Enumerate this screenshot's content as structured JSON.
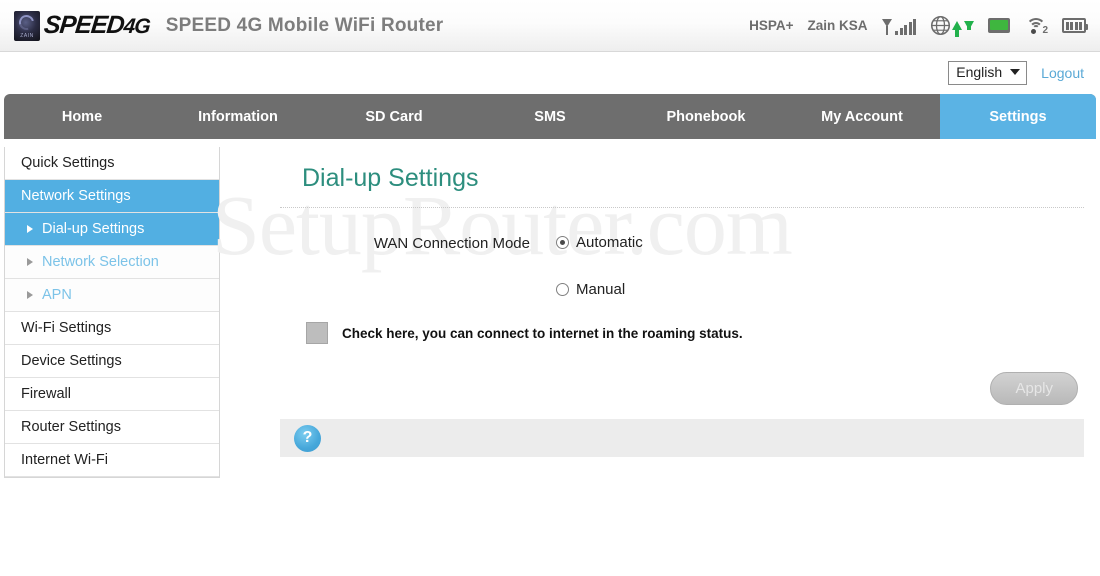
{
  "header": {
    "logo_mark": "zain-speed4g-logo",
    "logo_text_main": "SPEED",
    "logo_text_suffix": "4G",
    "logo_badge_text": "ZAIN",
    "title": "SPEED 4G Mobile WiFi Router",
    "status": {
      "network_type": "HSPA+",
      "carrier": "Zain KSA",
      "signal_icon": "signal-bars-icon",
      "data_icon": "globe-transfer-icon",
      "sms_icon": "sms-icon",
      "wifi_icon": "wifi-icon",
      "wifi_clients": "2",
      "battery_icon": "battery-icon"
    }
  },
  "subheader": {
    "language": "English",
    "logout": "Logout"
  },
  "nav": {
    "items": [
      {
        "label": "Home",
        "active": false
      },
      {
        "label": "Information",
        "active": false
      },
      {
        "label": "SD Card",
        "active": false
      },
      {
        "label": "SMS",
        "active": false
      },
      {
        "label": "Phonebook",
        "active": false
      },
      {
        "label": "My Account",
        "active": false
      },
      {
        "label": "Settings",
        "active": true
      }
    ]
  },
  "sidebar": {
    "items": [
      {
        "label": "Quick Settings"
      },
      {
        "label": "Network Settings"
      },
      {
        "label": "Dial-up Settings"
      },
      {
        "label": "Network Selection"
      },
      {
        "label": "APN"
      },
      {
        "label": "Wi-Fi Settings"
      },
      {
        "label": "Device Settings"
      },
      {
        "label": "Firewall"
      },
      {
        "label": "Router Settings"
      },
      {
        "label": "Internet Wi-Fi"
      }
    ]
  },
  "main": {
    "page_title": "Dial-up Settings",
    "watermark": "SetupRouter.com",
    "wan_mode_label": "WAN Connection Mode",
    "options": [
      {
        "label": "Automatic",
        "selected": true
      },
      {
        "label": "Manual",
        "selected": false
      }
    ],
    "roaming_text": "Check here, you can connect to internet in the roaming status.",
    "apply_label": "Apply",
    "help_icon_label": "?"
  },
  "colors": {
    "accent_blue": "#52afe2",
    "nav_gray": "#6e6e6e",
    "title_teal": "#2d8e7e",
    "status_green": "#22b14c",
    "link_blue": "#5aa9d6"
  }
}
